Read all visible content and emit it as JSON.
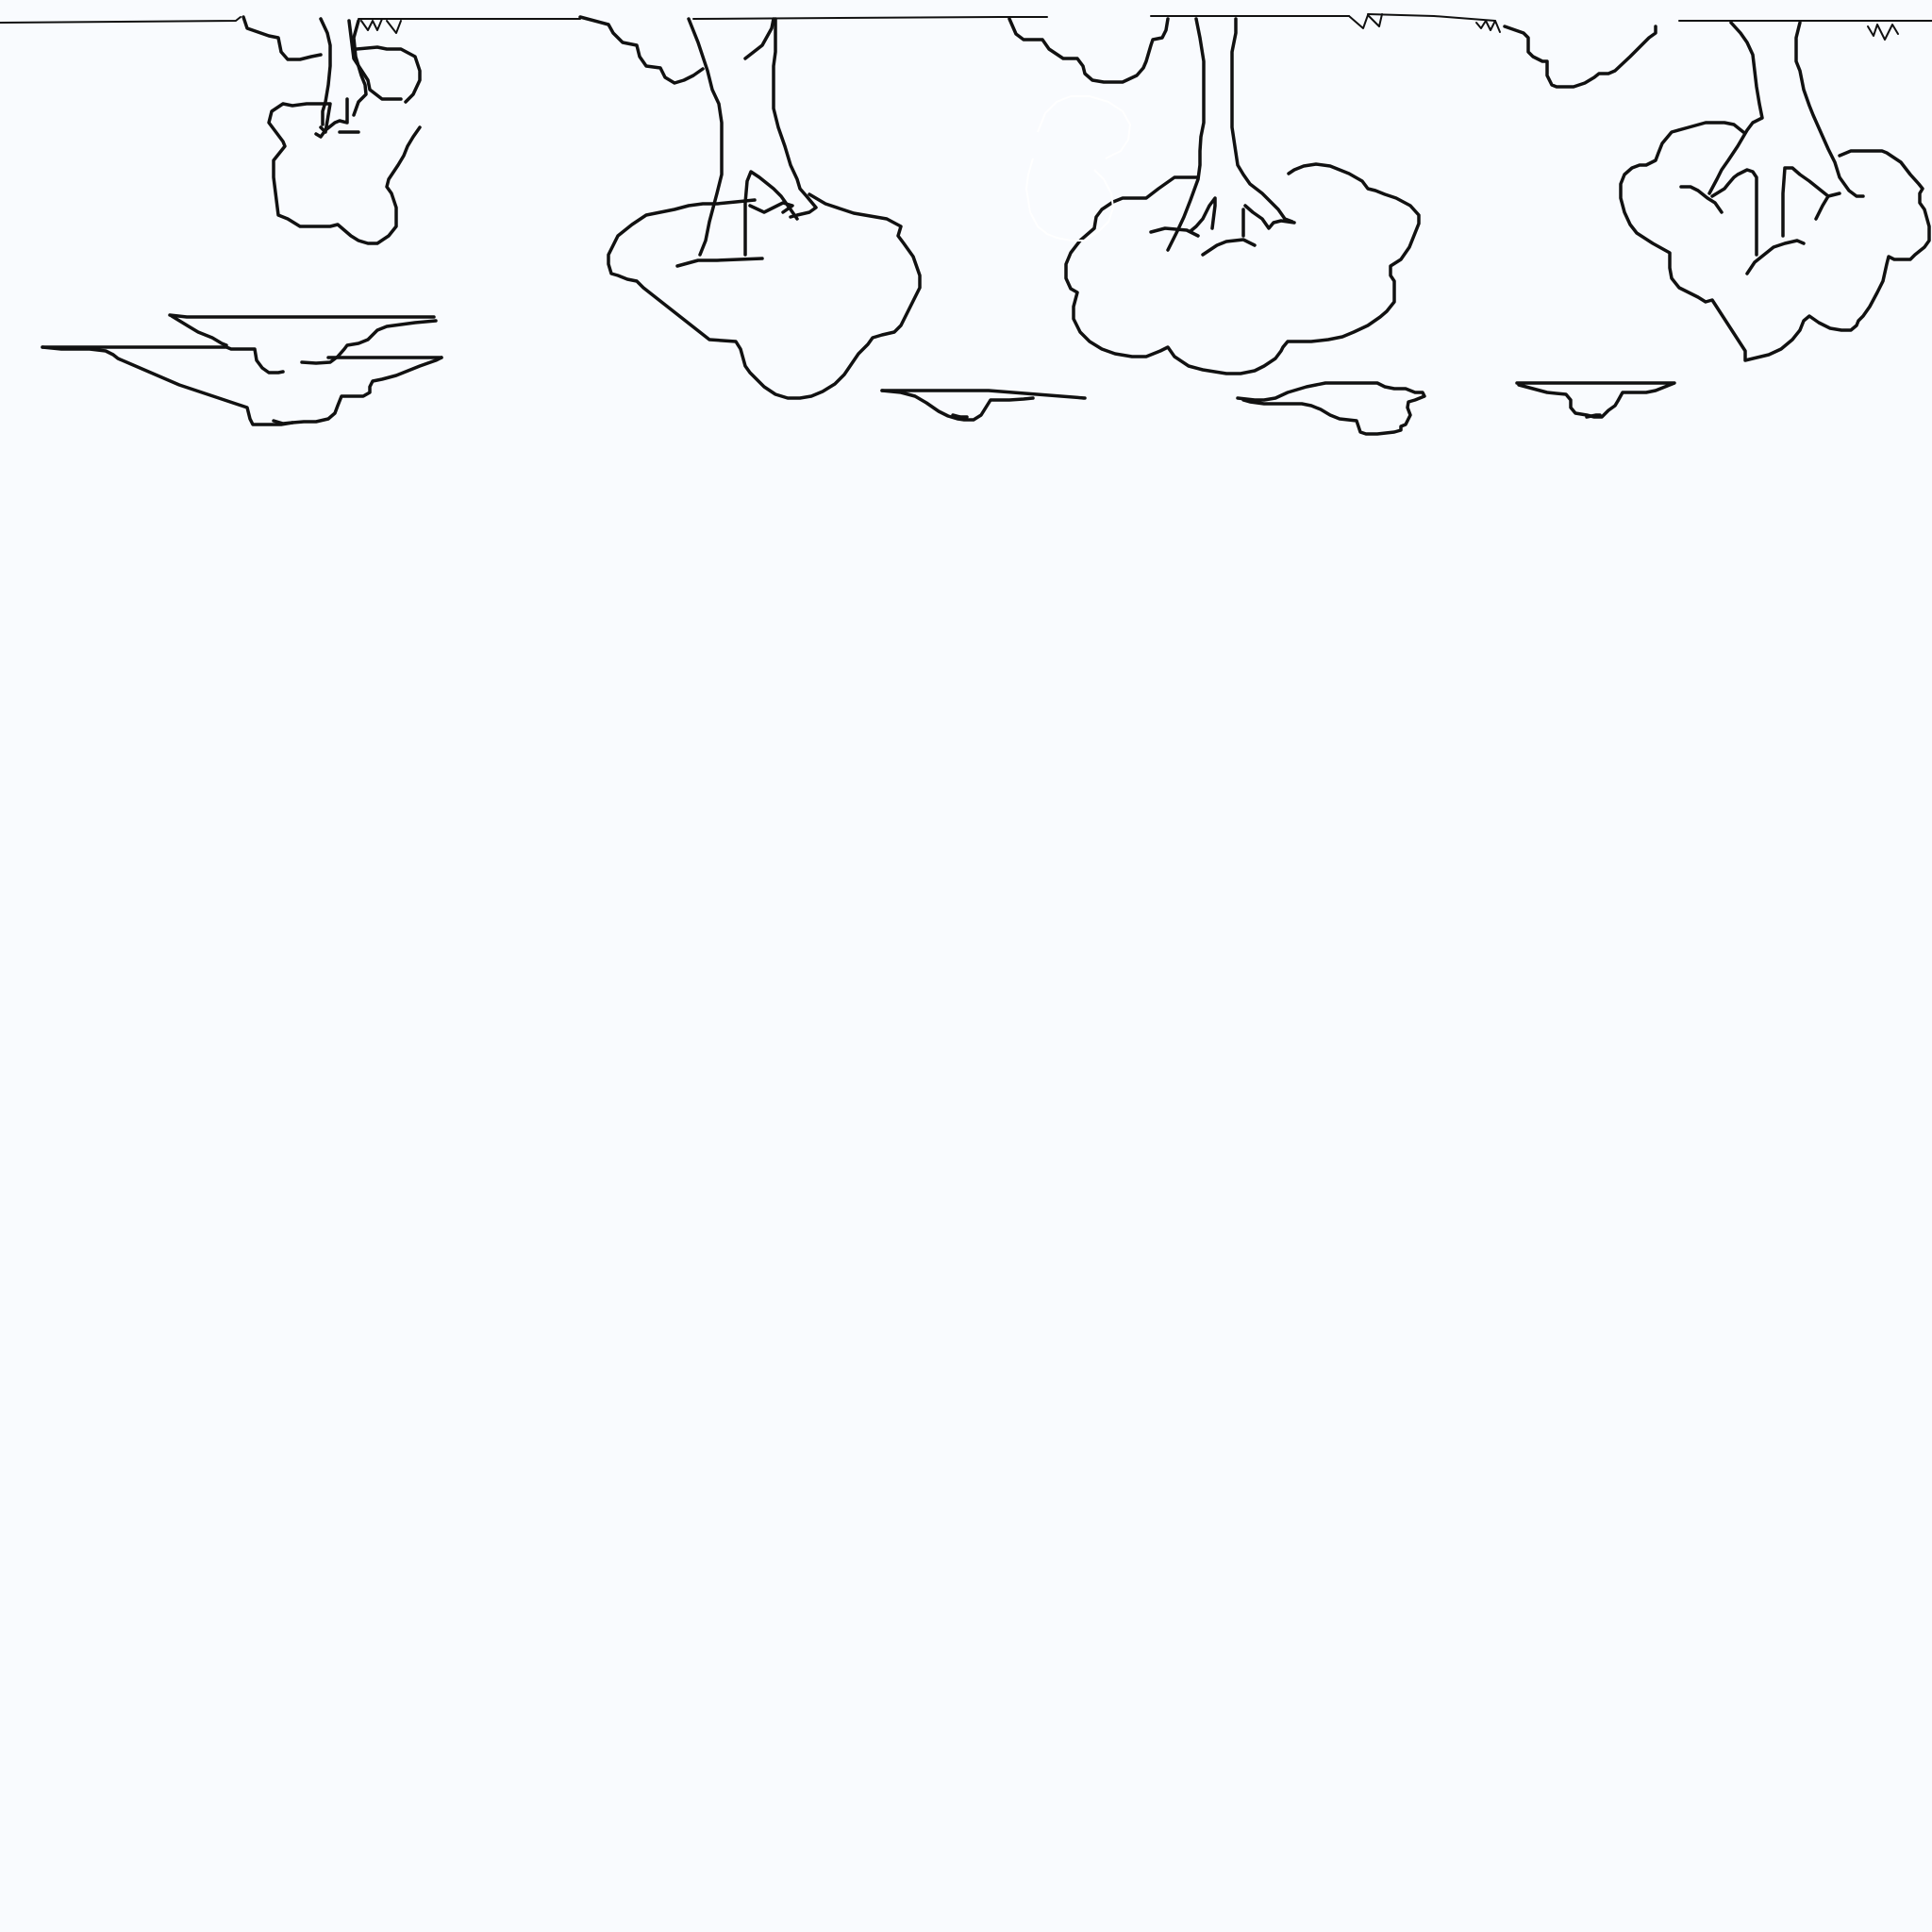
{
  "drawing": {
    "subject": "line-art-sketch",
    "orientation": "upside-down",
    "colors": {
      "background": "#f9fbfe",
      "stroke": "#111111"
    },
    "tree_count": 5,
    "cloud_count": 4
  }
}
